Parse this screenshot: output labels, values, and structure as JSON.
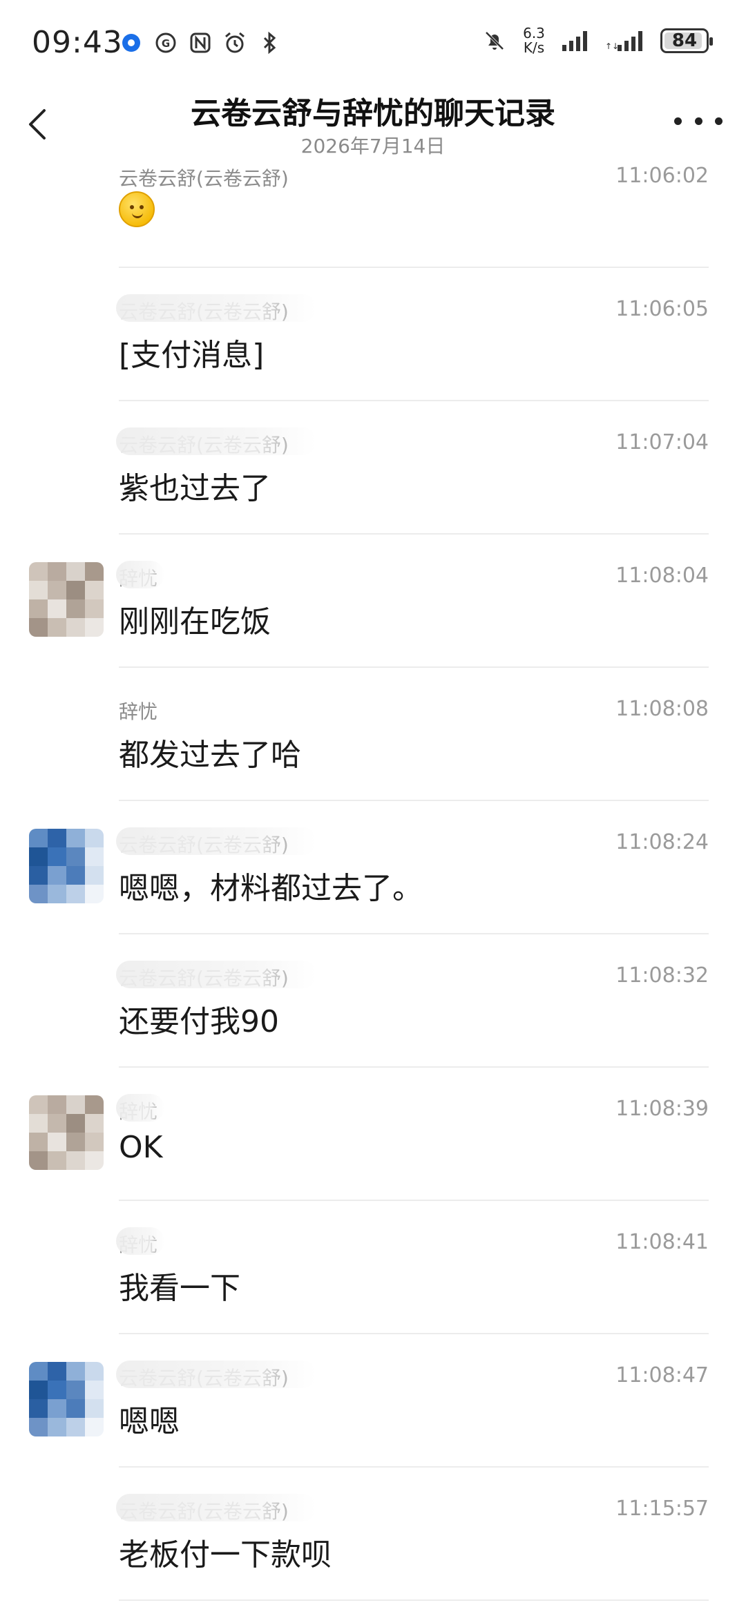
{
  "status_bar": {
    "time": "09:43",
    "net_speed_value": "6.3",
    "net_speed_unit": "K/s",
    "battery": "84"
  },
  "header": {
    "title": "云卷云舒与辞忧的聊天记录",
    "date": "2026年7月14日"
  },
  "messages": [
    {
      "sender": "云卷云舒(云卷云舒)",
      "time": "11:06:02",
      "content": "",
      "emoji": true,
      "blur": false,
      "avatar": null
    },
    {
      "sender": "云卷云舒(云卷云舒)",
      "time": "11:06:05",
      "content": "[支付消息]",
      "blur": true,
      "avatar": null
    },
    {
      "sender": "云卷云舒(云卷云舒)",
      "time": "11:07:04",
      "content": "紫也过去了",
      "blur": true,
      "avatar": null
    },
    {
      "sender": "辞忧",
      "time": "11:08:04",
      "content": "刚刚在吃饭",
      "blur": true,
      "avatar": "beige"
    },
    {
      "sender": "辞忧",
      "time": "11:08:08",
      "content": "都发过去了哈",
      "blur": false,
      "avatar": null
    },
    {
      "sender": "云卷云舒(云卷云舒)",
      "time": "11:08:24",
      "content": "嗯嗯，材料都过去了。",
      "blur": true,
      "avatar": "blue"
    },
    {
      "sender": "云卷云舒(云卷云舒)",
      "time": "11:08:32",
      "content": "还要付我90",
      "blur": true,
      "avatar": null
    },
    {
      "sender": "辞忧",
      "time": "11:08:39",
      "content": "OK",
      "blur": true,
      "avatar": "beige"
    },
    {
      "sender": "辞忧",
      "time": "11:08:41",
      "content": "我看一下",
      "blur": true,
      "avatar": null
    },
    {
      "sender": "云卷云舒(云卷云舒)",
      "time": "11:08:47",
      "content": "嗯嗯",
      "blur": true,
      "avatar": "blue"
    },
    {
      "sender": "云卷云舒(云卷云舒)",
      "time": "11:15:57",
      "content": "老板付一下款呗",
      "blur": true,
      "avatar": null
    }
  ],
  "colors": {
    "avatar_beige": [
      "#cfc4ba",
      "#b9aba0",
      "#d9d2cb",
      "#a8998c",
      "#e3ddd6",
      "#c4b8ad",
      "#9c8e82",
      "#dcd4cc",
      "#bfb2a6",
      "#e8e3de",
      "#b0a397",
      "#d2c8be",
      "#a39488",
      "#c9beb3",
      "#ddd6cf",
      "#ebe7e3"
    ],
    "avatar_blue": [
      "#5f8cc4",
      "#2e63a8",
      "#8fb0d8",
      "#c9d9ec",
      "#1f5596",
      "#3a72b8",
      "#5b87bf",
      "#e0e9f4",
      "#2a5fa2",
      "#7aa0d0",
      "#4c7cba",
      "#d3e0ef",
      "#6e93c6",
      "#9ab8dc",
      "#bdd0e8",
      "#f0f4f9"
    ]
  }
}
